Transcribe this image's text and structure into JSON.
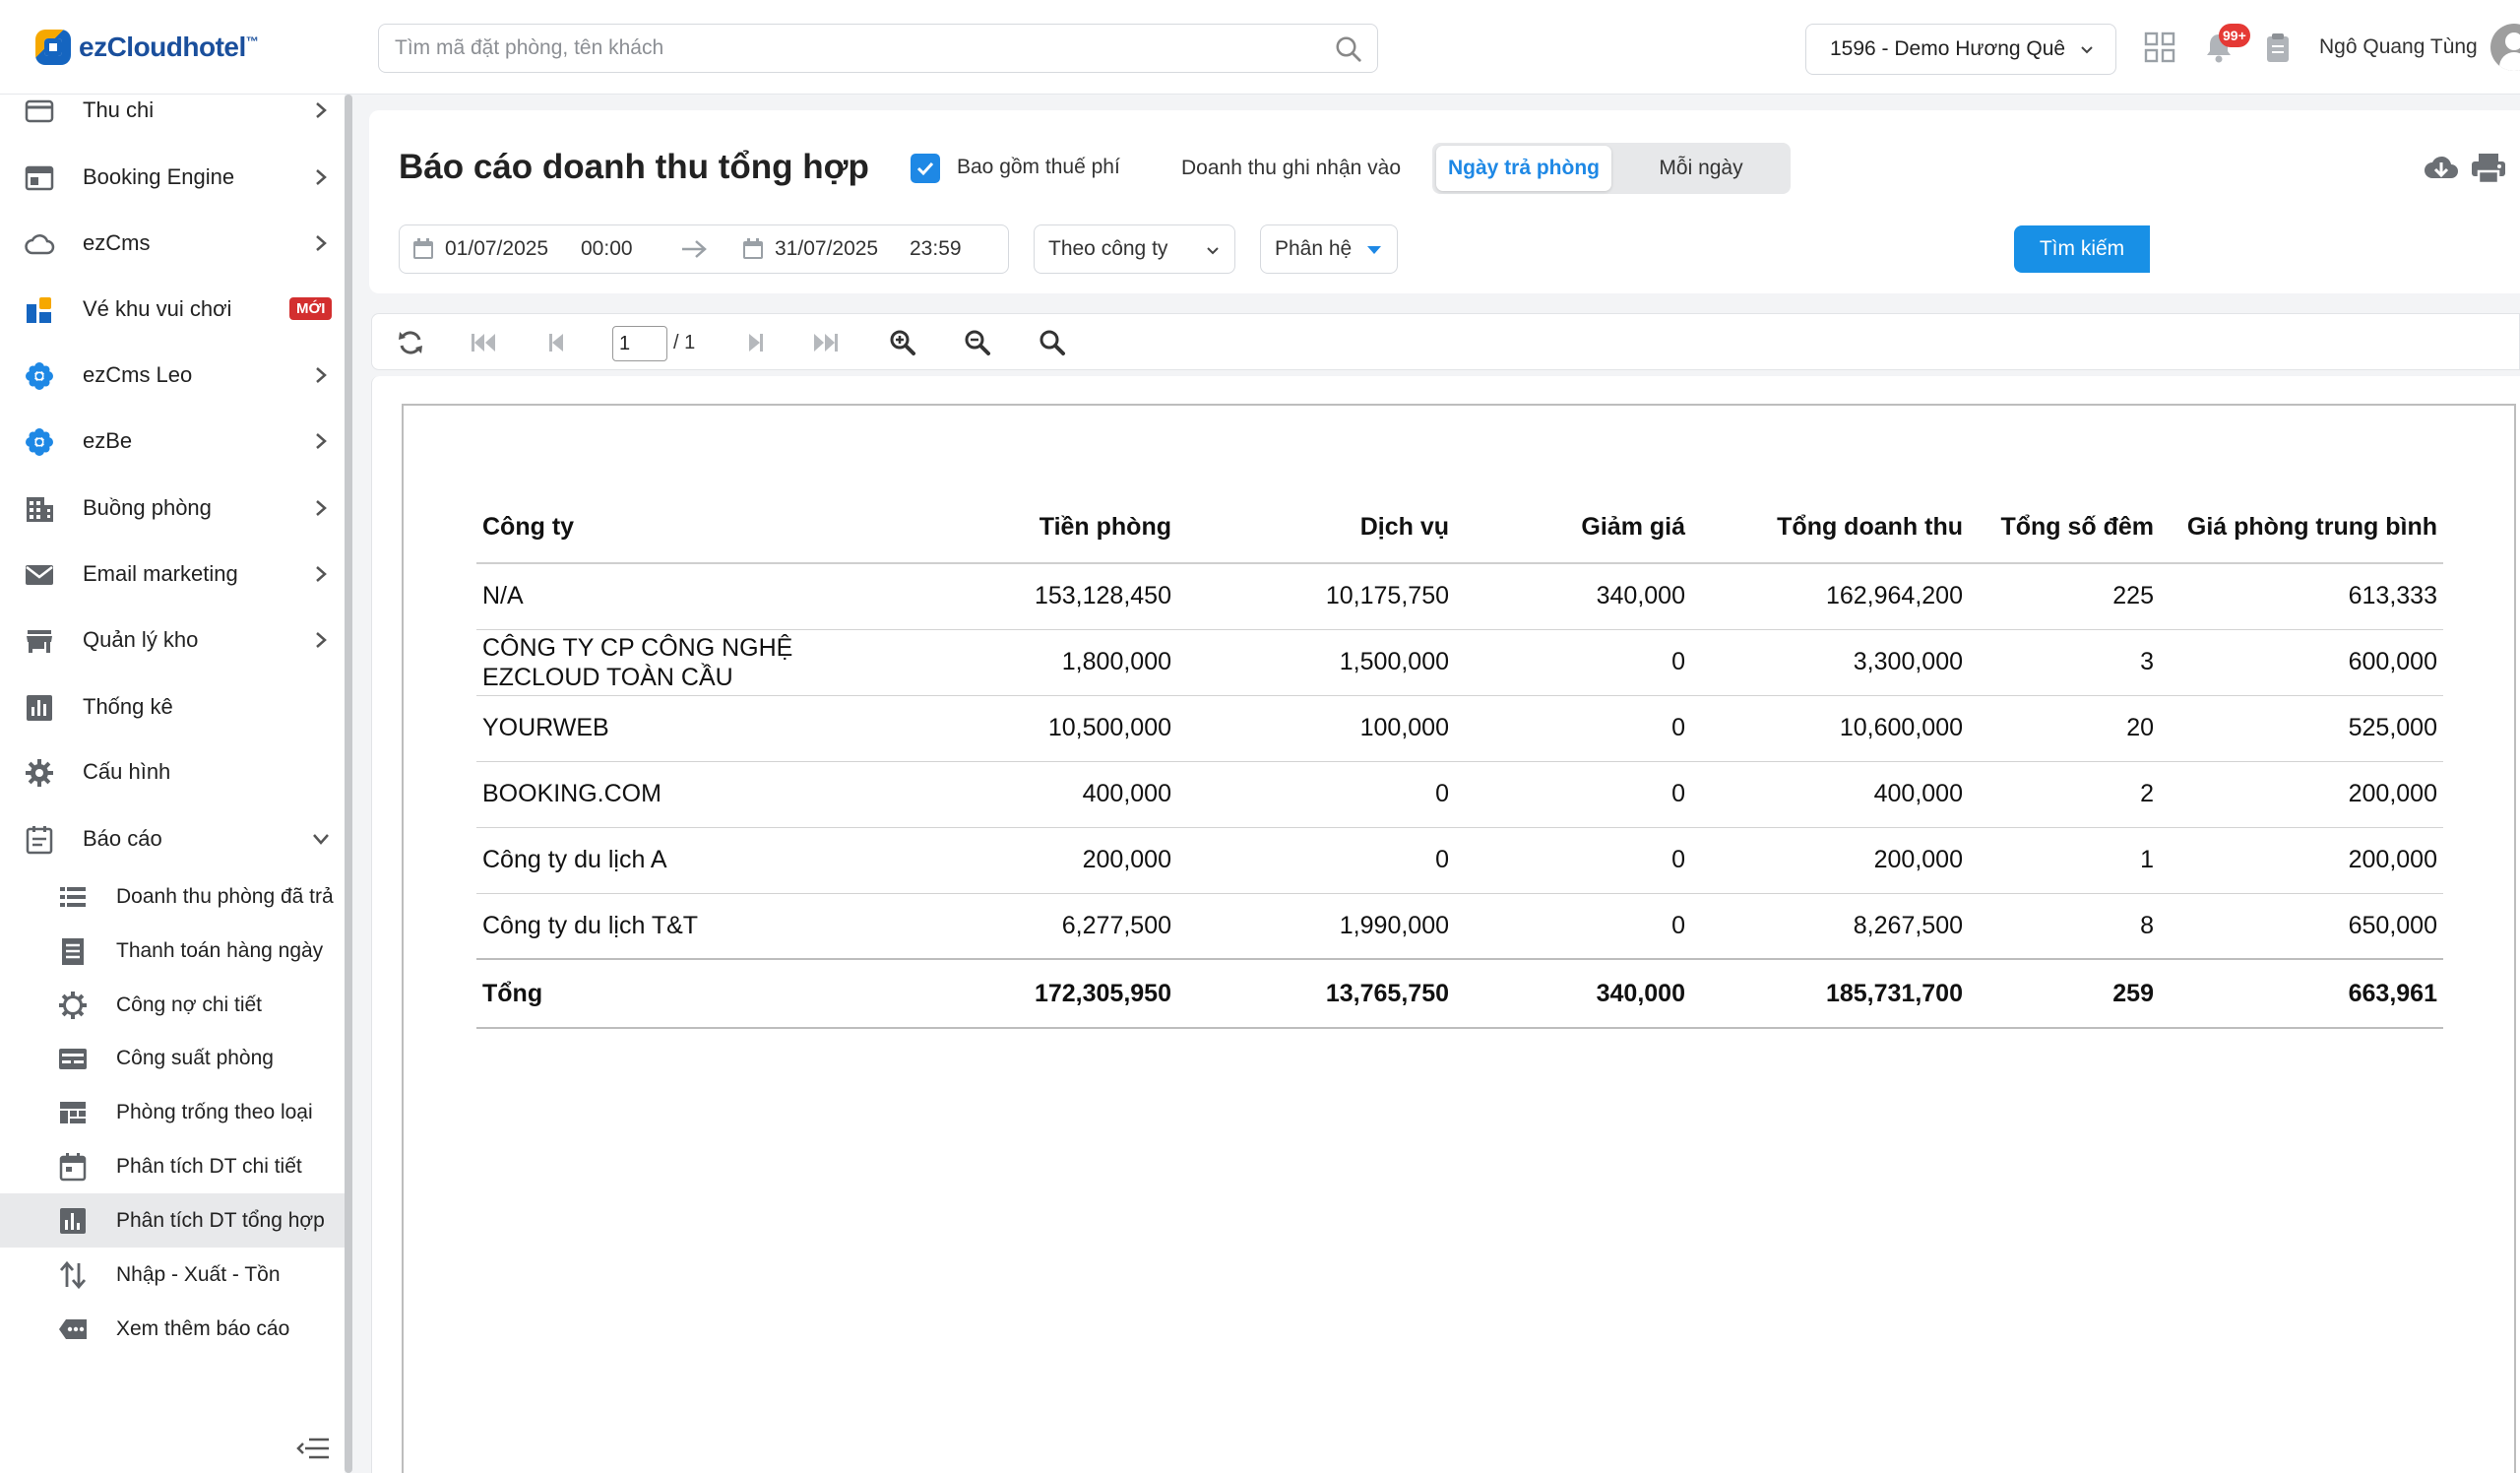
{
  "header": {
    "brand": "ezCloudhotel",
    "brand_tm": "™",
    "search_placeholder": "Tìm mã đặt phòng, tên khách",
    "hotel_selector": "1596 - Demo Hương Quê",
    "notification_count": "99+",
    "user_name": "Ngô Quang Tùng",
    "accent_color": "#1890e6",
    "badge_color": "#e53935"
  },
  "sidebar": {
    "items": [
      {
        "label": "Thu chi",
        "icon": "wallet-icon"
      },
      {
        "label": "Booking Engine",
        "icon": "browser-window-icon"
      },
      {
        "label": "ezCms",
        "icon": "cloud-icon"
      },
      {
        "label": "Vé khu vui chơi",
        "icon": "ticket-blocks-icon",
        "badge": "MỚI"
      },
      {
        "label": "ezCms Leo",
        "icon": "flower-icon"
      },
      {
        "label": "ezBe",
        "icon": "flower-icon"
      },
      {
        "label": "Buồng phòng",
        "icon": "building-icon"
      },
      {
        "label": "Email marketing",
        "icon": "envelope-icon"
      },
      {
        "label": "Quản lý kho",
        "icon": "store-icon"
      },
      {
        "label": "Thống kê",
        "icon": "bar-chart-icon"
      },
      {
        "label": "Cấu hình",
        "icon": "gear-icon"
      },
      {
        "label": "Báo cáo",
        "icon": "report-icon"
      }
    ],
    "report_subitems": [
      {
        "label": "Doanh thu phòng đã trả",
        "icon": "list-icon"
      },
      {
        "label": "Thanh toán hàng ngày",
        "icon": "document-lines-icon"
      },
      {
        "label": "Công nợ chi tiết",
        "icon": "cog-outline-icon"
      },
      {
        "label": "Công suất phòng",
        "icon": "card-icon"
      },
      {
        "label": "Phòng trống theo loại",
        "icon": "grid-icon"
      },
      {
        "label": "Phân tích DT chi tiết",
        "icon": "calendar-icon"
      },
      {
        "label": "Phân tích DT tổng hợp",
        "icon": "bar-chart-box-icon",
        "active": true
      },
      {
        "label": "Nhập - Xuất - Tồn",
        "icon": "swap-vertical-icon"
      },
      {
        "label": "Xem thêm báo cáo",
        "icon": "more-tag-icon"
      }
    ]
  },
  "report": {
    "title": "Báo cáo doanh thu tổng hợp",
    "include_tax_label": "Bao gồm thuế phí",
    "include_tax_checked": true,
    "revenue_recorded_label": "Doanh thu ghi nhận vào",
    "mode_active": "Ngày trả phòng",
    "mode_other": "Mỗi ngày",
    "date_from": "01/07/2025",
    "time_from": "00:00",
    "date_to": "31/07/2025",
    "time_to": "23:59",
    "group_by": "Theo công ty",
    "section": "Phân hệ",
    "search_button": "Tìm kiếm"
  },
  "viewer": {
    "page_current": "1",
    "page_total": "/ 1"
  },
  "table": {
    "headers": [
      "Công ty",
      "Tiền phòng",
      "Dịch vụ",
      "Giảm giá",
      "Tổng doanh thu",
      "Tổng số đêm",
      "Giá phòng trung bình"
    ],
    "rows": [
      {
        "company": "N/A",
        "room": "153,128,450",
        "service": "10,175,750",
        "discount": "340,000",
        "total": "162,964,200",
        "nights": "225",
        "avg": "613,333"
      },
      {
        "company": "CÔNG TY CP CÔNG NGHỆ",
        "company2": "EZCLOUD TOÀN CẦU",
        "room": "1,800,000",
        "service": "1,500,000",
        "discount": "0",
        "total": "3,300,000",
        "nights": "3",
        "avg": "600,000"
      },
      {
        "company": "YOURWEB",
        "room": "10,500,000",
        "service": "100,000",
        "discount": "0",
        "total": "10,600,000",
        "nights": "20",
        "avg": "525,000"
      },
      {
        "company": "BOOKING.COM",
        "room": "400,000",
        "service": "0",
        "discount": "0",
        "total": "400,000",
        "nights": "2",
        "avg": "200,000"
      },
      {
        "company": "Công ty du lịch A",
        "room": "200,000",
        "service": "0",
        "discount": "0",
        "total": "200,000",
        "nights": "1",
        "avg": "200,000"
      },
      {
        "company": "Công ty du lịch T&T",
        "room": "6,277,500",
        "service": "1,990,000",
        "discount": "0",
        "total": "8,267,500",
        "nights": "8",
        "avg": "650,000"
      }
    ],
    "total": {
      "label": "Tổng",
      "room": "172,305,950",
      "service": "13,765,750",
      "discount": "340,000",
      "total": "185,731,700",
      "nights": "259",
      "avg": "663,961"
    }
  }
}
